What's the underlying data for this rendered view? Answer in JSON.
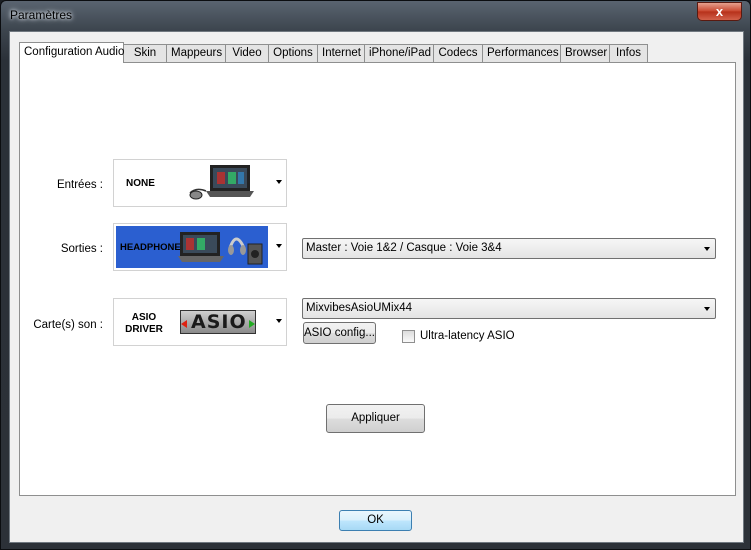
{
  "window": {
    "title": "Paramètres",
    "close_glyph": "x"
  },
  "tabs": [
    {
      "label": "Configuration Audio",
      "active": true
    },
    {
      "label": "Skin"
    },
    {
      "label": "Mappeurs"
    },
    {
      "label": "Video"
    },
    {
      "label": "Options"
    },
    {
      "label": "Internet"
    },
    {
      "label": "iPhone/iPad"
    },
    {
      "label": "Codecs"
    },
    {
      "label": "Performances"
    },
    {
      "label": "Browser"
    },
    {
      "label": "Infos"
    }
  ],
  "audio": {
    "inputs": {
      "label": "Entrées :",
      "device_text": "NONE"
    },
    "outputs": {
      "label": "Sorties :",
      "device_text": "HEADPHONES",
      "routing_value": "Master : Voie 1&2 / Casque : Voie 3&4"
    },
    "soundcard": {
      "label": "Carte(s) son :",
      "device_text_line1": "ASIO",
      "device_text_line2": "DRIVER",
      "logo_text": "ASIO",
      "driver_value": "MixvibesAsioUMix44",
      "config_button": "ASIO config...",
      "ultra_latency_label": "Ultra-latency ASIO",
      "ultra_latency_checked": false
    },
    "apply_button": "Appliquer"
  },
  "footer": {
    "ok_button": "OK"
  },
  "colors": {
    "headphones_bg": "#2b5fd0",
    "ok_border": "#3c7fb1",
    "close_red": "#c8442c"
  }
}
